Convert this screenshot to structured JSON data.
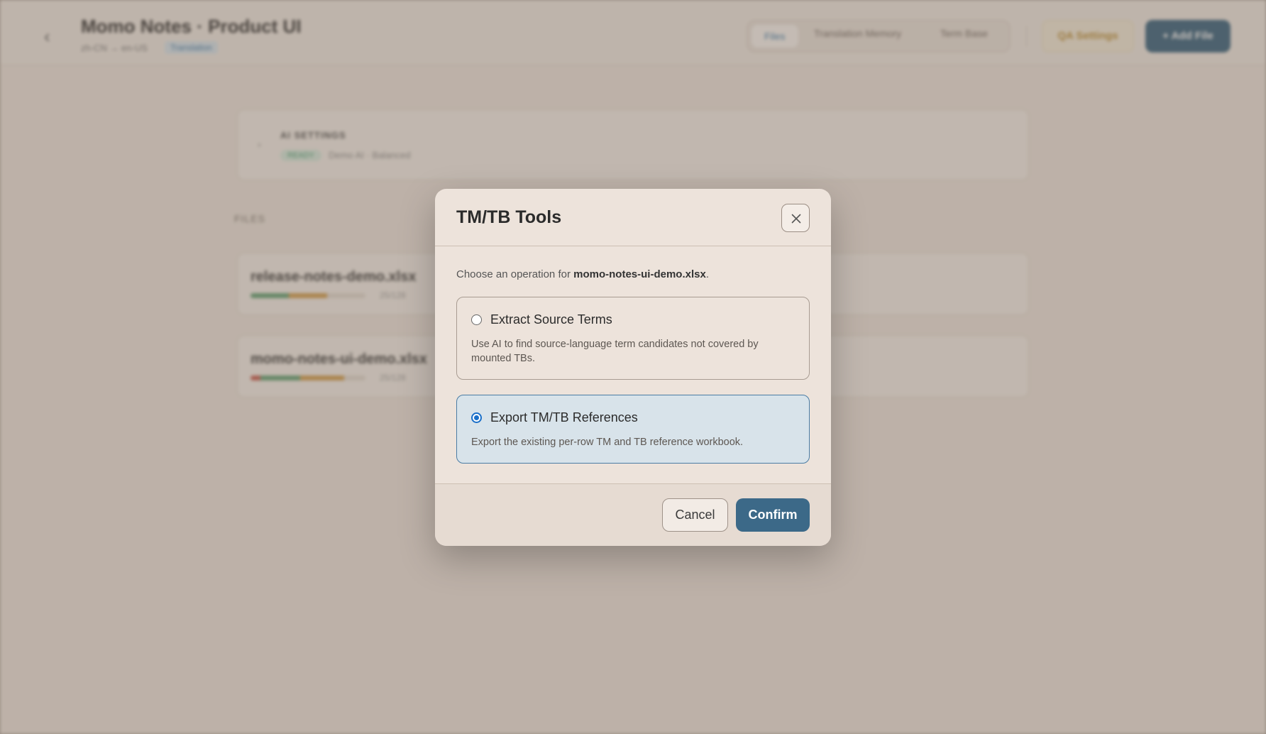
{
  "background": {
    "header": {
      "back_icon": "chevron-left-icon",
      "title": "Momo Notes · Product UI",
      "subtitle": "zh-CN → en-US",
      "tag": "Translation",
      "tabs": [
        {
          "label": "Files",
          "active": true
        },
        {
          "label": "Translation Memory",
          "active": false
        },
        {
          "label": "Term Base",
          "active": false
        }
      ],
      "qa_button": "QA Settings",
      "add_button": "+ Add File"
    },
    "ai_settings": {
      "title": "AI SETTINGS",
      "badge": "READY",
      "description": "Demo AI · Balanced"
    },
    "files_label": "FILES",
    "files": [
      {
        "name": "release-notes-demo.xlsx",
        "count": "25/128",
        "progress": {
          "done": 0.33,
          "review": 0.42
        }
      },
      {
        "name": "momo-notes-ui-demo.xlsx",
        "count": "25/128",
        "progress": {
          "error": 0.08,
          "done": 0.42,
          "review": 0.82
        }
      }
    ]
  },
  "modal": {
    "title": "TM/TB Tools",
    "close_icon": "close-icon",
    "intro_prefix": "Choose an operation for ",
    "intro_file": "momo-notes-ui-demo.xlsx",
    "intro_suffix": ".",
    "options": [
      {
        "title": "Extract Source Terms",
        "description": "Use AI to find source-language term candidates not covered by mounted TBs.",
        "selected": false
      },
      {
        "title": "Export TM/TB References",
        "description": "Export the existing per-row TM and TB reference workbook.",
        "selected": true
      }
    ],
    "cancel_label": "Cancel",
    "confirm_label": "Confirm"
  },
  "colors": {
    "accent": "#3c6988",
    "selected_bg": "#d8e3ea",
    "radio": "#1a6fc9"
  }
}
